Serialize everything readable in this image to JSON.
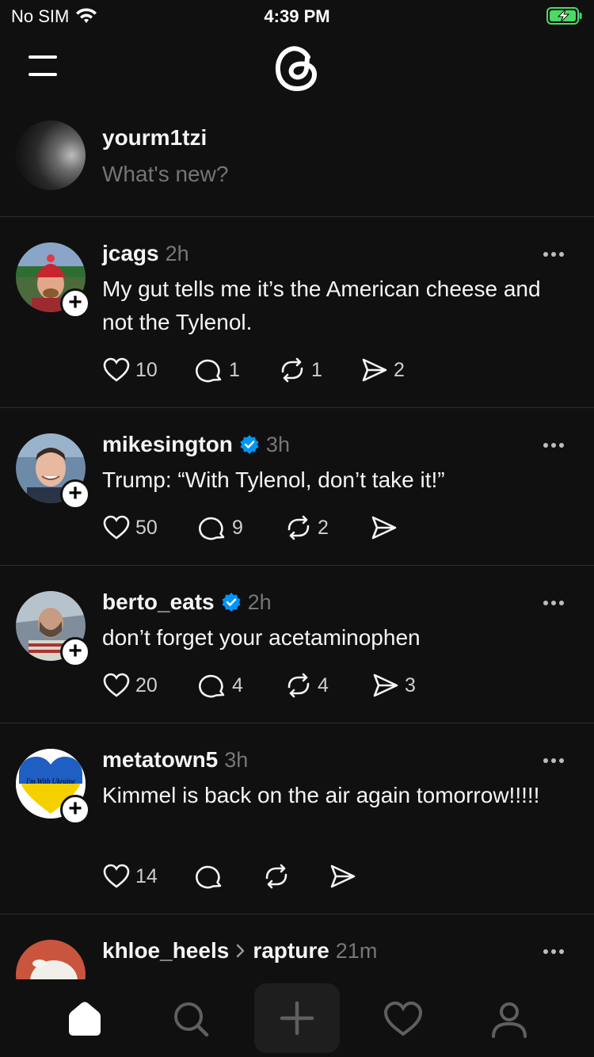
{
  "status_bar": {
    "carrier": "No SIM",
    "time": "4:39 PM"
  },
  "composer": {
    "username": "yourm1tzi",
    "placeholder": "What's new?"
  },
  "posts": [
    {
      "username": "jcags",
      "time": "2h",
      "verified": false,
      "text": "My gut tells me it’s the American cheese and not the Tylenol.",
      "likes": "10",
      "replies": "1",
      "reposts": "1",
      "shares": "2"
    },
    {
      "username": "mikesington",
      "time": "3h",
      "verified": true,
      "text": "Trump: “With Tylenol, don’t take it!”",
      "likes": "50",
      "replies": "9",
      "reposts": "2",
      "shares": ""
    },
    {
      "username": "berto_eats",
      "time": "2h",
      "verified": true,
      "text": "don’t forget your acetaminophen",
      "likes": "20",
      "replies": "4",
      "reposts": "4",
      "shares": "3"
    },
    {
      "username": "metatown5",
      "time": "3h",
      "verified": false,
      "avatar_caption": "I'm With Ukraine",
      "text": "Kimmel is back on the air again tomorrow!!!!!",
      "likes": "14",
      "replies": "",
      "reposts": "",
      "shares": ""
    },
    {
      "username": "khloe_heels",
      "topic": "rapture",
      "time": "21m",
      "verified": false
    }
  ],
  "icons": {
    "menu": "hamburger-icon",
    "logo": "threads-logo-icon",
    "like": "heart-icon",
    "reply": "comment-icon",
    "repost": "repost-icon",
    "share": "send-icon",
    "tabs": [
      "home-icon",
      "search-icon",
      "plus-icon",
      "heart-icon",
      "profile-icon"
    ]
  },
  "colors": {
    "background": "#101010",
    "text": "#f3f5f7",
    "muted": "#777777",
    "verified": "#0095f6",
    "battery": "#4cd964"
  }
}
